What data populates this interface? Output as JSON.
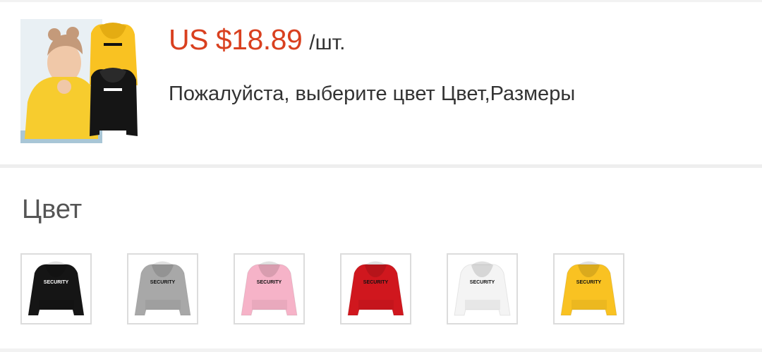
{
  "product": {
    "price": "US $18.89",
    "unit": "/шт.",
    "hint": "Пожалуйста, выберите цвет Цвет,Размеры",
    "thumbnail_icon": "product-photo-icon",
    "print_text": "SECURITY"
  },
  "color_section": {
    "title": "Цвет",
    "options": [
      {
        "name": "black",
        "color": "#151515",
        "text_color": "#ffffff"
      },
      {
        "name": "gray",
        "color": "#a8a8a8",
        "text_color": "#111111"
      },
      {
        "name": "pink",
        "color": "#f6b3c8",
        "text_color": "#111111"
      },
      {
        "name": "red",
        "color": "#d0171e",
        "text_color": "#111111"
      },
      {
        "name": "white",
        "color": "#f4f4f4",
        "text_color": "#111111"
      },
      {
        "name": "yellow",
        "color": "#f9c222",
        "text_color": "#111111"
      }
    ]
  }
}
